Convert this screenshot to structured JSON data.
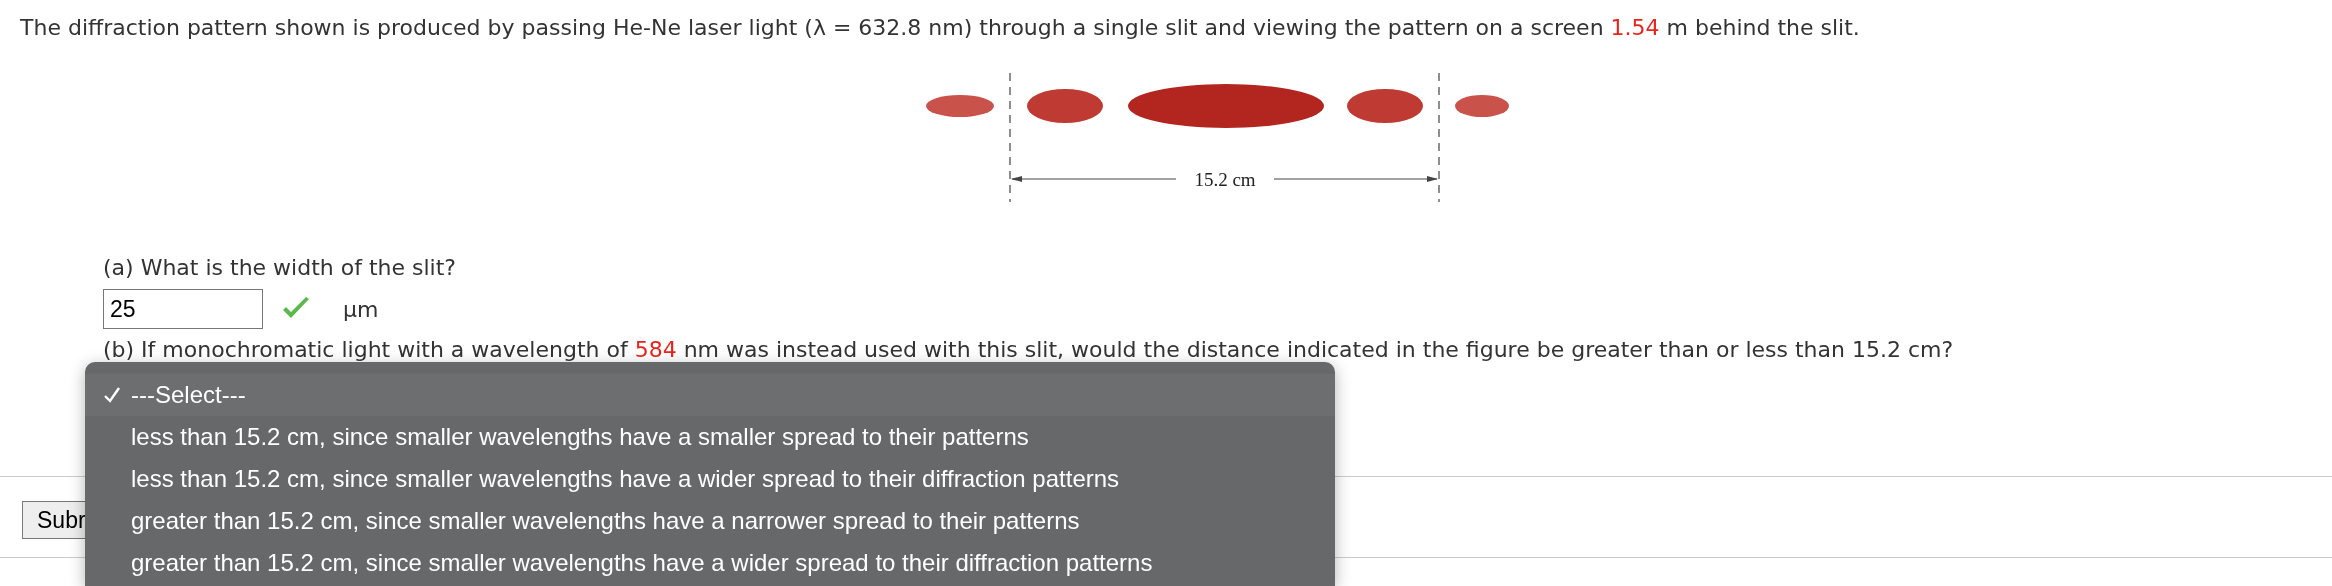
{
  "intro": [
    {
      "text": "The diffraction pattern shown is produced by passing He-Ne laser light (λ = 632.8 nm) through a single slit and viewing the pattern on a screen ",
      "highlight": false
    },
    {
      "text": "1.54",
      "highlight": true
    },
    {
      "text": " m behind the slit.",
      "highlight": false
    }
  ],
  "figure": {
    "dimension_label": "15.2 cm"
  },
  "part_a": {
    "prompt": "(a) What is the width of the slit?",
    "answer": {
      "value": "25",
      "correct": true
    },
    "unit": "μm"
  },
  "part_b": {
    "prompt": [
      {
        "text": "(b) If monochromatic light with a wavelength of ",
        "highlight": false
      },
      {
        "text": "584",
        "highlight": true
      },
      {
        "text": " nm was instead used with this slit, would the distance indicated in the figure be greater than or less than 15.2 cm?",
        "highlight": false
      }
    ]
  },
  "dropdown": {
    "options": [
      {
        "label": "---Select---",
        "selected": true
      },
      {
        "label": "less than 15.2 cm, since smaller wavelengths have a smaller spread to their patterns",
        "selected": false
      },
      {
        "label": "less than 15.2 cm, since smaller wavelengths have a wider spread to their diffraction patterns",
        "selected": false
      },
      {
        "label": "greater than 15.2 cm, since smaller wavelengths have a narrower spread to their patterns",
        "selected": false
      },
      {
        "label": "greater than 15.2 cm, since smaller wavelengths have a wider spread to their diffraction patterns",
        "selected": false
      }
    ]
  },
  "submit_button": {
    "label": "Subr"
  }
}
